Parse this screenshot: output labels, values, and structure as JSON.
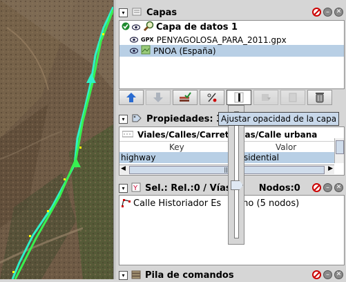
{
  "colors": {
    "selection": "#b8cfe5",
    "tooltip_bg": "#c8d8ea",
    "track": "#2ef2c8"
  },
  "layers": {
    "title": "Capas",
    "items": [
      {
        "name": "Capa de datos 1",
        "icon": "magnifier-layer-icon",
        "checked": true
      },
      {
        "prefix": "GPX",
        "name": "PENYAGOLOSA_PARA_2011.gpx",
        "icon": "gpx-icon"
      },
      {
        "name": "PNOA (España)",
        "icon": "imagery-icon",
        "selected": true
      }
    ],
    "toolbar": [
      "move-up-icon",
      "move-down-icon",
      "merge-icon",
      "opacity-icon",
      "opacity-slider-icon",
      "download-icon",
      "duplicate-icon",
      "delete-icon"
    ]
  },
  "tooltip": "Ajustar opacidad de la capa",
  "properties": {
    "title": "Propiedades: 3",
    "subtitle": "Viales/Calles/Carret",
    "subtitle_tail": "as/Calle urbana",
    "columns": [
      "Key",
      "Valor"
    ],
    "rows": [
      {
        "key": "highway",
        "value": "sidential"
      }
    ],
    "scroll_mark": "|||"
  },
  "selection": {
    "title": "Sel.: Rel.:0 / Vías:",
    "title_tail": "Nodos:0",
    "items": [
      {
        "label": "Calle Historiador Es",
        "label_tail": "ano (5 nodos)",
        "icon": "way-icon"
      }
    ]
  },
  "commands": {
    "title": "Pila de comandos"
  }
}
